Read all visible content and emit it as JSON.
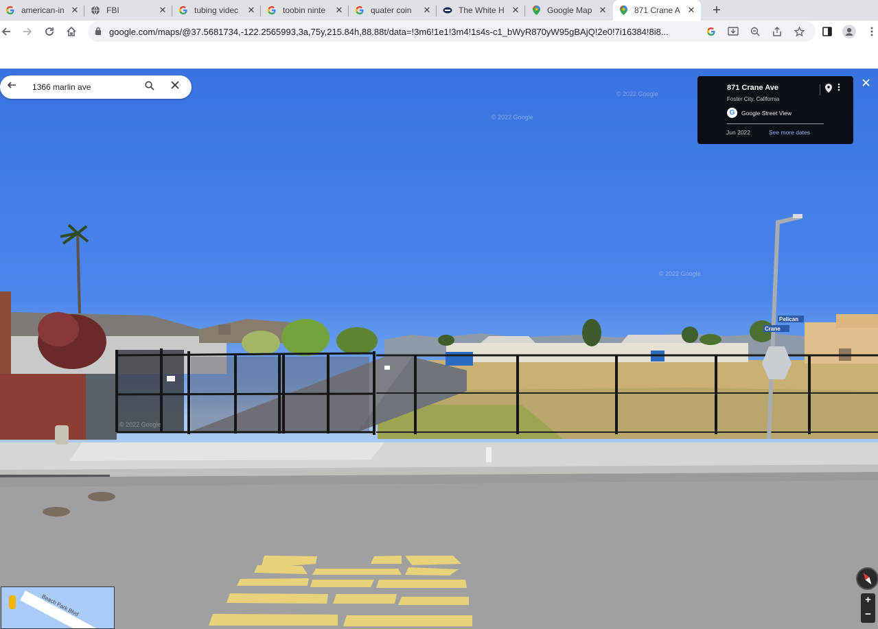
{
  "browser": {
    "tabs": [
      {
        "title": "american-in",
        "icon": "google-icon",
        "active": false
      },
      {
        "title": "FBI",
        "icon": "globe-icon",
        "active": false
      },
      {
        "title": "tubing videc",
        "icon": "google-icon",
        "active": false
      },
      {
        "title": "toobin ninte",
        "icon": "google-icon",
        "active": false
      },
      {
        "title": "quater coin",
        "icon": "google-icon",
        "active": false
      },
      {
        "title": "The White H",
        "icon": "whitehouse-icon",
        "active": false
      },
      {
        "title": "Google Map",
        "icon": "maps-pin-icon",
        "active": false
      },
      {
        "title": "871 Crane A",
        "icon": "maps-pin-icon",
        "active": true
      }
    ],
    "close_glyph": "✕",
    "new_tab_glyph": "+",
    "url": "google.com/maps/@37.5681734,-122.2565993,3a,75y,215.84h,88.88t/data=!3m6!1e1!3m4!1s4s-c1_bWyR870yW95gBAjQ!2e0!7i16384!8i8..."
  },
  "maps": {
    "search": {
      "query": "1366 marlin ave"
    },
    "info_card": {
      "address": "871 Crane Ave",
      "city": "Foster City, California",
      "source": "Google Street View",
      "date": "Jun 2022",
      "more_dates": "See more dates"
    },
    "street_signs": {
      "upper": "Pelican",
      "lower": "Crane"
    },
    "watermark": "© 2022 Google",
    "zoom": {
      "plus": "+",
      "minus": "−"
    },
    "minimap": {
      "road_label": "Beach Park Blvd"
    }
  },
  "colors": {
    "sky": "#3873e0",
    "card_bg": "#0b0f16",
    "link": "#8ab4f8",
    "street_paint": "#e8d27a"
  }
}
